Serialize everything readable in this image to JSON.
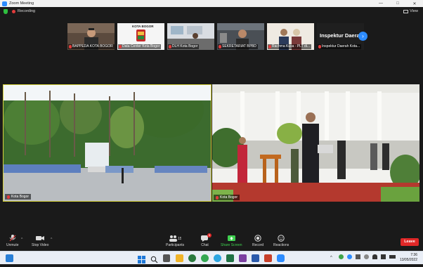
{
  "window": {
    "title": "Zoom Meeting",
    "controls": [
      "—",
      "□",
      "✕"
    ]
  },
  "status": {
    "recording_label": "Recording",
    "view_label": "View"
  },
  "thumbnails": [
    {
      "name": "BAPPEDA KOTA BOGOR",
      "muted": true
    },
    {
      "name": "Data Center Kota Bogor",
      "muted": true
    },
    {
      "name": "DLH Kota Bogor",
      "muted": true
    },
    {
      "name": "SEKRETARIAT BPBD",
      "muted": true
    },
    {
      "name": "Rachma Kusa - PLT di...",
      "muted": true
    },
    {
      "name": "Inspektur Daerah Kota...",
      "muted": true,
      "display": "Inspektur Daera..."
    }
  ],
  "tiles": [
    {
      "name": "Kota Bogor",
      "active": true
    },
    {
      "name": "Kota Bogor",
      "active": false
    }
  ],
  "toolbar": {
    "unmute": "Unmute",
    "stop_video": "Stop Video",
    "participants": "Participants",
    "participants_count": "15",
    "chat": "Chat",
    "chat_badge": "5",
    "share_screen": "Share Screen",
    "record": "Record",
    "reactions": "Reactions",
    "leave": "Leave"
  },
  "taskbar": {
    "time": "7:36",
    "date": "13/05/2022"
  },
  "colors": {
    "zoom_blue": "#2d8cff",
    "active_speaker_border": "#d6d23a",
    "leave_red": "#e02828",
    "share_green": "#3fd14f"
  }
}
